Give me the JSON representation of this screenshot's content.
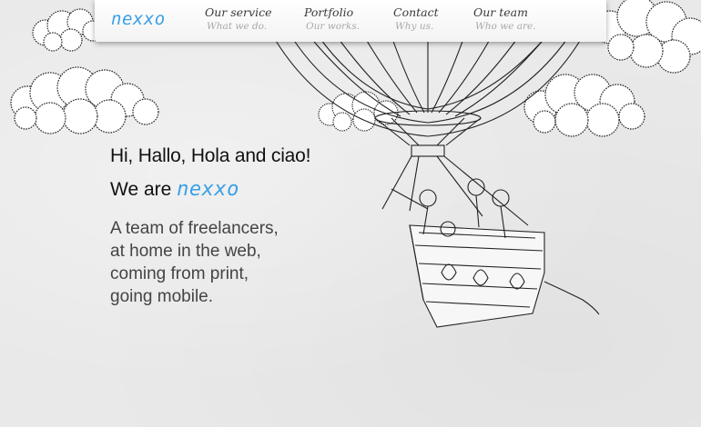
{
  "brand": {
    "name": "nexxo",
    "color": "#3aa0e6"
  },
  "nav": {
    "items": [
      {
        "title": "Our service",
        "subtitle": "What we do."
      },
      {
        "title": "Portfolio",
        "subtitle": "Our works."
      },
      {
        "title": "Contact",
        "subtitle": "Why us."
      },
      {
        "title": "Our team",
        "subtitle": "Who we are."
      }
    ]
  },
  "hero": {
    "greeting": "Hi, Hallo, Hola and ciao!",
    "we_are": "We are ",
    "description": [
      "A team of freelancers,",
      "at home in the web,",
      "coming from print,",
      "going mobile."
    ]
  },
  "illustration": {
    "icons": [
      "cloud-icon",
      "hot-air-balloon-icon"
    ]
  }
}
